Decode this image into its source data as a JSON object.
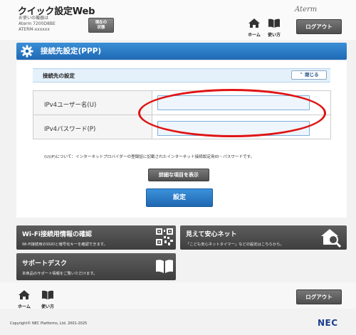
{
  "header": {
    "app_title": "クイック設定Web",
    "device_label": "お使いの機器は",
    "device_model": "Aterm 7200D8BE",
    "device_name": "ATERM-xxxxxx",
    "status_button": "現在の\n状態",
    "brand": "Aterm",
    "home_label": "ホーム",
    "manual_label": "使い方",
    "logout_label": "ログアウト"
  },
  "section": {
    "title": "接続先設定(PPP)",
    "subsection_title": "接続先の設定",
    "collapse_label": "閉じる"
  },
  "form": {
    "username_label": "IPv4ユーザー名(U)",
    "username_value": "",
    "password_label": "IPv4パスワード(P)",
    "password_value": "",
    "note": "(U)(P)について：インターネットプロバイダーの登録証に記載されたインターネット接続設定用ID・パスワードです。",
    "details_button": "詳細な項目を表示",
    "apply_button": "設定"
  },
  "tiles": [
    {
      "title": "Wi-Fi接続用情報の確認",
      "desc": "Wi-Fi接続用のSSIDと暗号化キーを確認できます。",
      "icon": "qr-code-icon"
    },
    {
      "title": "見えて安心ネット",
      "desc": "「こども安心ネットタイマー」などの設定はこちらから。",
      "icon": "house-search-icon"
    },
    {
      "title": "サポートデスク",
      "desc": "本商品のサポート情報をご覧いただけます。",
      "icon": "book-icon"
    }
  ],
  "footer": {
    "home_label": "ホーム",
    "manual_label": "使い方",
    "logout_label": "ログアウト",
    "copyright": "Copyright© NEC Platforms, Ltd. 2001-2025",
    "company": "NEC"
  },
  "colors": {
    "primary_blue": "#1f69b5",
    "highlight_red": "#e01414",
    "tile_gray": "#4a4a4a"
  }
}
